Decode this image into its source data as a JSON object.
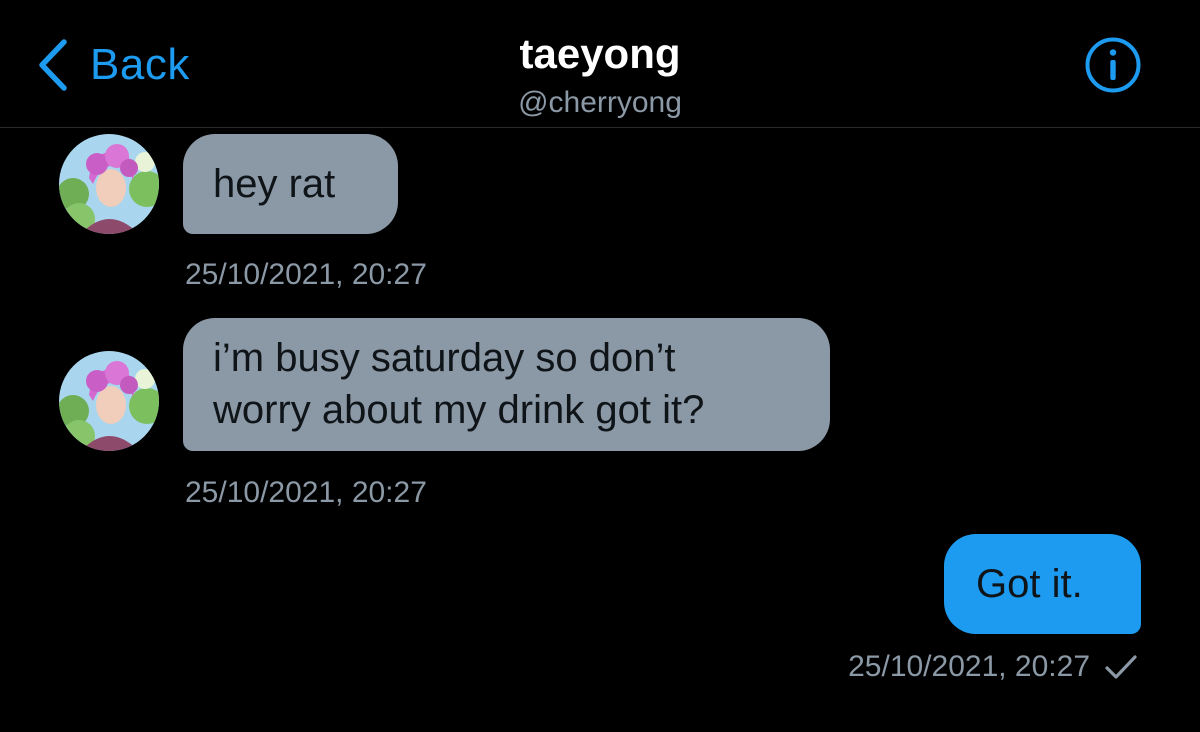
{
  "header": {
    "back_label": "Back",
    "title": "taeyong",
    "handle": "@cherryong",
    "icons": {
      "back": "chevron-left-icon",
      "info": "info-circle-icon"
    }
  },
  "colors": {
    "accent": "#1d9bf0",
    "received_bubble": "#8b98a5",
    "muted_text": "#8b98a5",
    "background": "#000000"
  },
  "messages": [
    {
      "direction": "received",
      "lines": [
        "hey rat"
      ],
      "timestamp": "25/10/2021, 20:27"
    },
    {
      "direction": "received",
      "lines": [
        "i’m busy saturday so don’t",
        "worry about my drink got it?"
      ],
      "timestamp": "25/10/2021, 20:27"
    },
    {
      "direction": "sent",
      "lines": [
        "Got it."
      ],
      "timestamp": "25/10/2021, 20:27",
      "status_icon": "checkmark-icon"
    }
  ]
}
